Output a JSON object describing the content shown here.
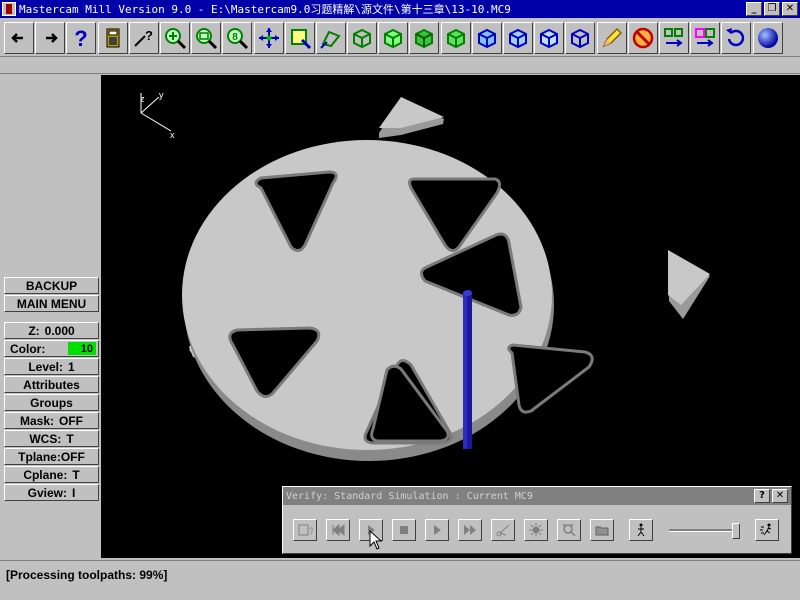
{
  "window": {
    "title": "Mastercam Mill Version 9.0 - E:\\Mastercam9.0习题精解\\源文件\\第十三章\\13-10.MC9",
    "controls": [
      "_",
      "❐",
      "✕"
    ]
  },
  "toolbar": {
    "buttons": [
      "back-arrow",
      "forward-arrow",
      "help",
      "calculator",
      "whats-this",
      "zoom-window",
      "zoom-out",
      "zoom-fit",
      "pan",
      "select-chain",
      "analyze",
      "view-top",
      "view-front",
      "view-side",
      "view-iso",
      "view-cube-1",
      "view-cube-2",
      "view-cube-3",
      "view-cube-4",
      "shade",
      "no-shade",
      "transform",
      "color",
      "undo",
      "sphere"
    ]
  },
  "left_menu": {
    "backup": "BACKUP",
    "main_menu": "MAIN MENU",
    "z_label": "Z:",
    "z_value": "0.000",
    "color_label": "Color:",
    "color_value": "10",
    "level_label": "Level:",
    "level_value": "1",
    "attributes": "Attributes",
    "groups": "Groups",
    "mask_label": "Mask:",
    "mask_value": "OFF",
    "wcs_label": "WCS:",
    "wcs_value": "T",
    "tplane": "Tplane:OFF",
    "cplane_label": "Cplane:",
    "cplane_value": "T",
    "gview_label": "Gview:",
    "gview_value": "I"
  },
  "axes": {
    "x": "x",
    "y": "y",
    "z": "z"
  },
  "verify": {
    "title": "Verify: Standard Simulation : Current MC9",
    "help": "?",
    "close": "✕",
    "speed": 0.88
  },
  "status": {
    "text": "[Processing toolpaths:    99%]"
  }
}
